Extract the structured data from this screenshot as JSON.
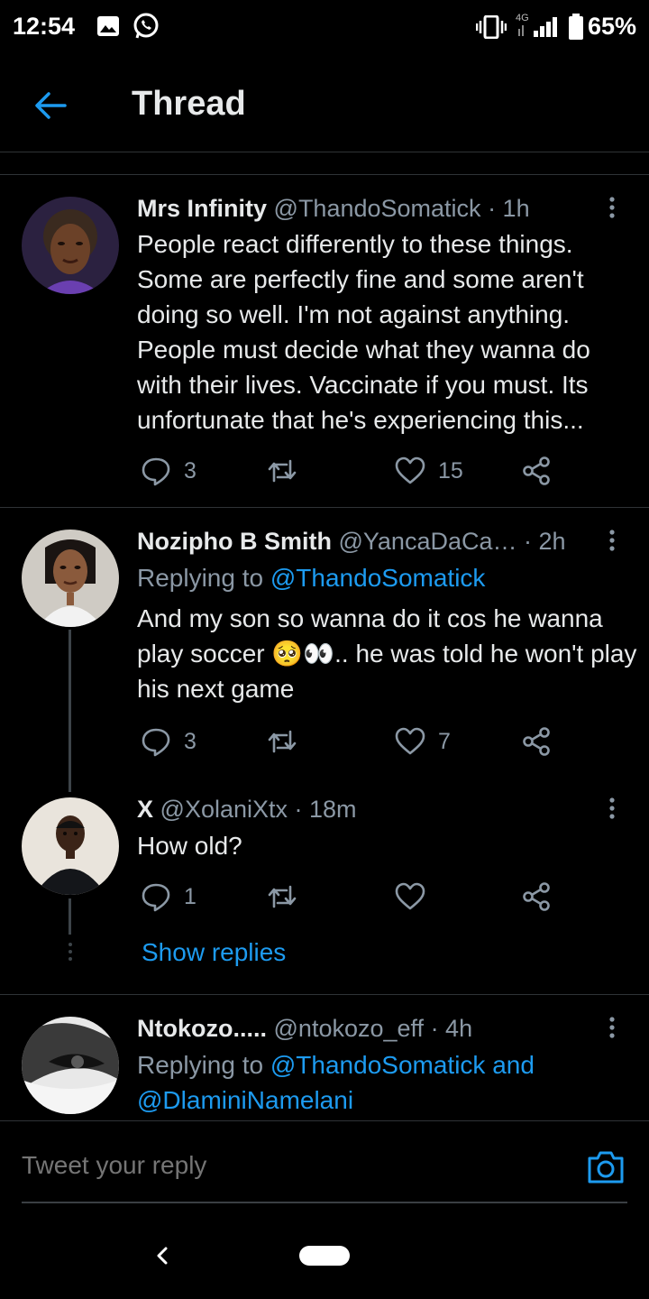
{
  "status_bar": {
    "time": "12:54",
    "network": "4G",
    "battery": "65%"
  },
  "header": {
    "title": "Thread"
  },
  "tweets": [
    {
      "name": "Mrs Infinity",
      "handle": "@ThandoSomatick",
      "time": "· 1h",
      "text": "People react differently to these things. Some are perfectly fine and some aren't doing so well. I'm not against anything. People must decide what they wanna do with their lives. Vaccinate if you must. Its unfortunate that he's experiencing this...",
      "replies": "3",
      "retweets": "",
      "likes": "15"
    },
    {
      "name": "Nozipho B Smith",
      "handle": "@YancaDaCa…",
      "time": "· 2h",
      "replying_prefix": "Replying to ",
      "replying_to": "@ThandoSomatick",
      "text": "And my son so wanna do it cos he wanna play soccer 🥺👀.. he was told he won't play his next game",
      "replies": "3",
      "retweets": "",
      "likes": "7"
    },
    {
      "name": "X",
      "handle": "@XolaniXtx",
      "time": "· 18m",
      "text": "How old?",
      "replies": "1",
      "retweets": "",
      "likes": ""
    },
    {
      "name": "Ntokozo.....",
      "handle": "@ntokozo_eff",
      "time": "· 4h",
      "replying_prefix": "Replying to ",
      "replying_to": "@ThandoSomatick and",
      "replying_to_2": "@DlaminiNamelani"
    }
  ],
  "show_replies": "Show replies",
  "reply_bar": {
    "placeholder": "Tweet your reply"
  },
  "colors": {
    "accent": "#1d9bf0",
    "muted": "#8b98a5",
    "background": "#000000"
  },
  "icons": [
    "back-arrow-icon",
    "reply-icon",
    "retweet-icon",
    "like-icon",
    "share-icon",
    "more-icon",
    "camera-icon"
  ]
}
